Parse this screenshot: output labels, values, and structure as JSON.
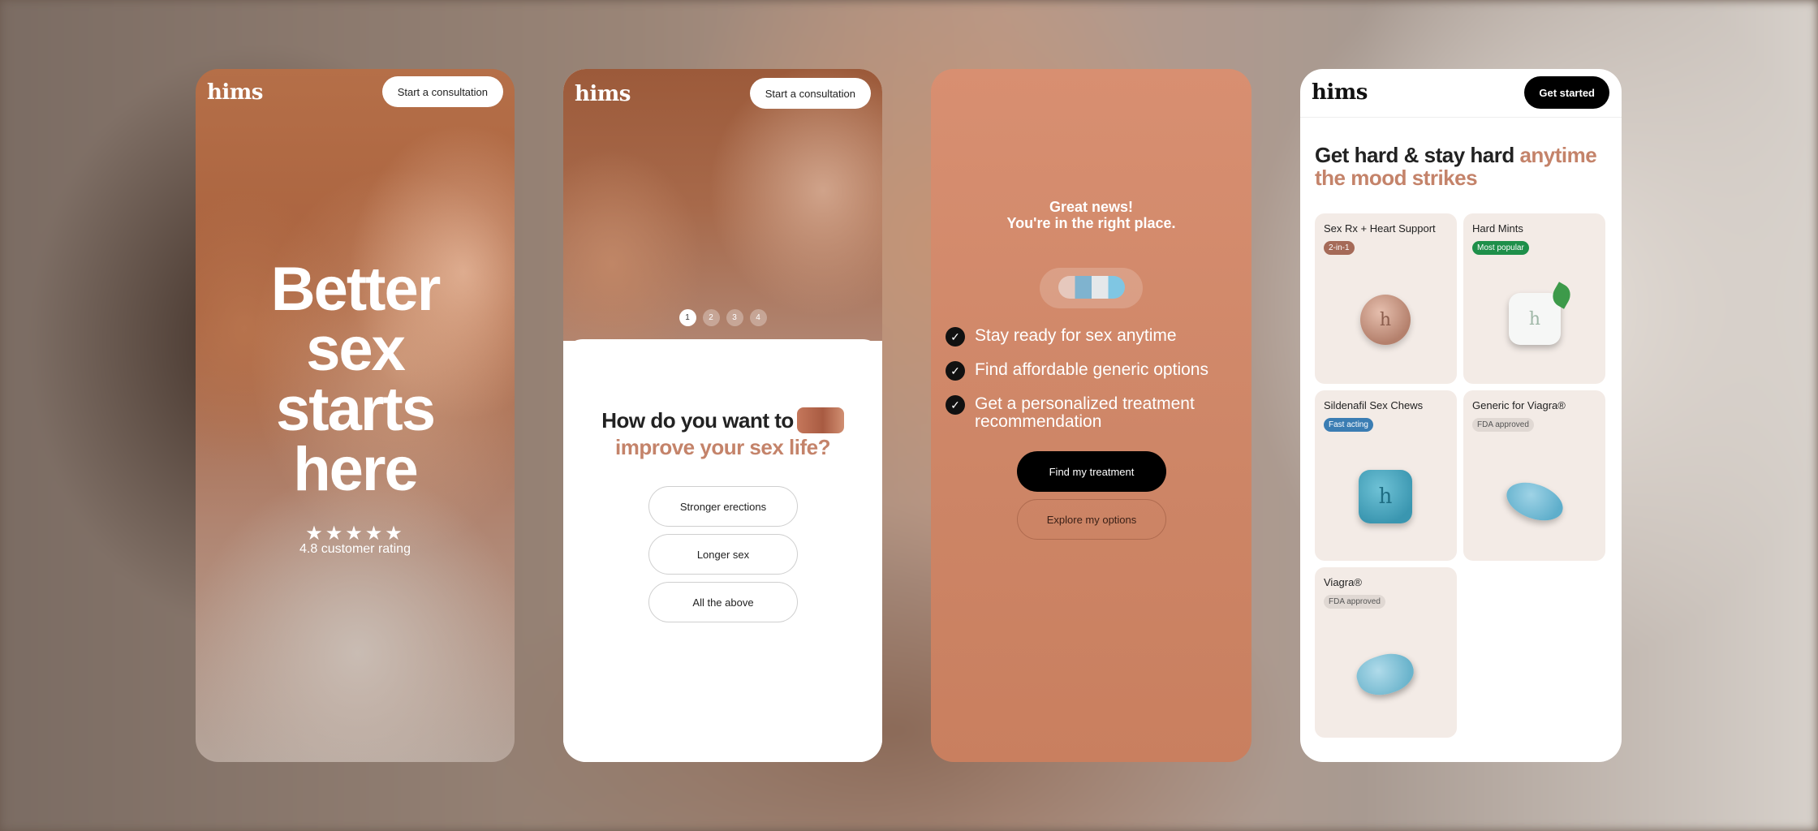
{
  "card1": {
    "logo": "hims",
    "consult_button": "Start a consultation",
    "headline": "Better\nsex\nstarts\nhere",
    "stars": "★★★★★",
    "rating_text": "4.8 customer rating"
  },
  "card2": {
    "logo": "hims",
    "consult_button": "Start a consultation",
    "carousel_dots": [
      "1",
      "2",
      "3",
      "4"
    ],
    "active_dot": 1,
    "question_line1": "How do you want to",
    "question_line2": "improve your sex life?",
    "options": [
      "Stronger erections",
      "Longer sex",
      "All the above"
    ]
  },
  "card3": {
    "news_line1": "Great news!",
    "news_line2": "You're in the right place.",
    "checklist": [
      "Stay ready for sex anytime",
      "Find affordable generic options",
      "Get a personalized treatment recommendation"
    ],
    "primary_cta": "Find my treatment",
    "secondary_cta": "Explore my options"
  },
  "card4": {
    "logo": "hims",
    "get_started": "Get started",
    "headline_dark": "Get hard & stay hard ",
    "headline_accent": "anytime the mood strikes",
    "products": [
      {
        "name": "Sex Rx + Heart Support",
        "badge": "2-in-1",
        "badge_style": "brown"
      },
      {
        "name": "Hard Mints",
        "badge": "Most popular",
        "badge_style": "green"
      },
      {
        "name": "Sildenafil Sex Chews",
        "badge": "Fast acting",
        "badge_style": "blue"
      },
      {
        "name": "Generic for Viagra®",
        "badge": "FDA approved",
        "badge_style": "gray"
      },
      {
        "name": "Viagra®",
        "badge": "FDA approved",
        "badge_style": "gray"
      }
    ],
    "pill_letter": "h"
  },
  "colors": {
    "accent": "#c4836a",
    "card3_bg": "#d88f71",
    "badge_green": "#1e8f4a",
    "badge_blue": "#3b7db3"
  }
}
